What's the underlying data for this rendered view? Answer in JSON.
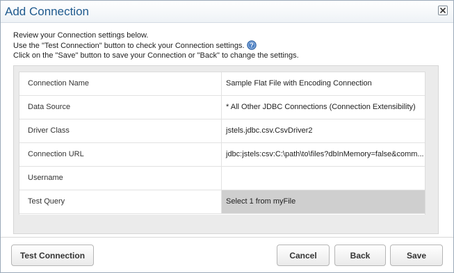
{
  "dialog": {
    "title": "Add Connection",
    "close_icon": "close-icon"
  },
  "instructions": {
    "line1": "Review your Connection settings below.",
    "line2": "Use the \"Test Connection\" button to check your Connection settings.",
    "line3": "Click on the \"Save\" button to save your Connection or \"Back\" to change the settings.",
    "help_icon": "question-circle-icon"
  },
  "settings": {
    "rows": [
      {
        "label": "Connection Name",
        "value": "Sample Flat File with Encoding Connection"
      },
      {
        "label": "Data Source",
        "value": "* All Other JDBC Connections (Connection Extensibility)"
      },
      {
        "label": "Driver Class",
        "value": "jstels.jdbc.csv.CsvDriver2"
      },
      {
        "label": "Connection URL",
        "value": "jdbc:jstels:csv:C:\\path\\to\\files?dbInMemory=false&comm..."
      },
      {
        "label": "Username",
        "value": ""
      },
      {
        "label": "Test Query",
        "value": "Select 1 from myFile"
      }
    ],
    "selected_row": 5
  },
  "footer": {
    "test_connection_label": "Test Connection",
    "cancel_label": "Cancel",
    "back_label": "Back",
    "save_label": "Save"
  },
  "colors": {
    "title": "#1f5a8e",
    "selected_cell": "#cfcfcf",
    "panel_bg": "#ebebeb"
  }
}
